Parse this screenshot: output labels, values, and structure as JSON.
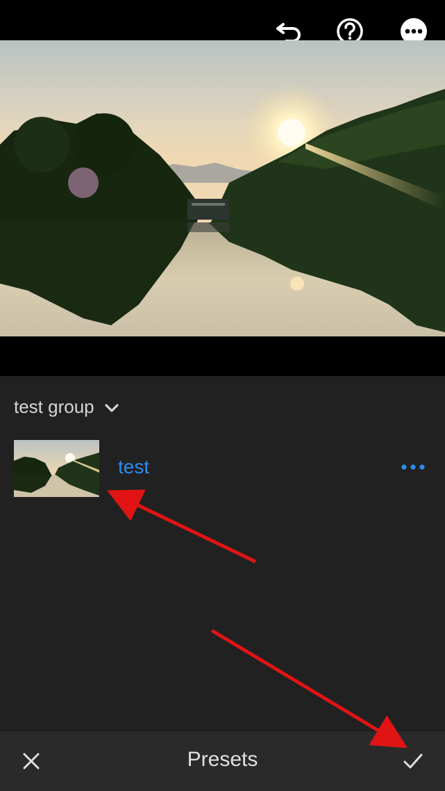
{
  "toolbar": {
    "undo_icon": "undo-arrow-icon",
    "help_icon": "question-circle-icon",
    "more_icon": "more-horizontal-circle-icon"
  },
  "photo": {
    "description_icon": "landscape-photo"
  },
  "presets": {
    "group_label": "test group",
    "items": [
      {
        "name": "test"
      }
    ]
  },
  "bottom_bar": {
    "title": "Presets",
    "cancel_icon": "close-icon",
    "confirm_icon": "checkmark-icon"
  },
  "colors": {
    "panel_bg": "#212121",
    "bottom_bar_bg": "#2a2a2a",
    "accent_blue": "#2d8ceb",
    "annotation_red": "#e01414"
  }
}
